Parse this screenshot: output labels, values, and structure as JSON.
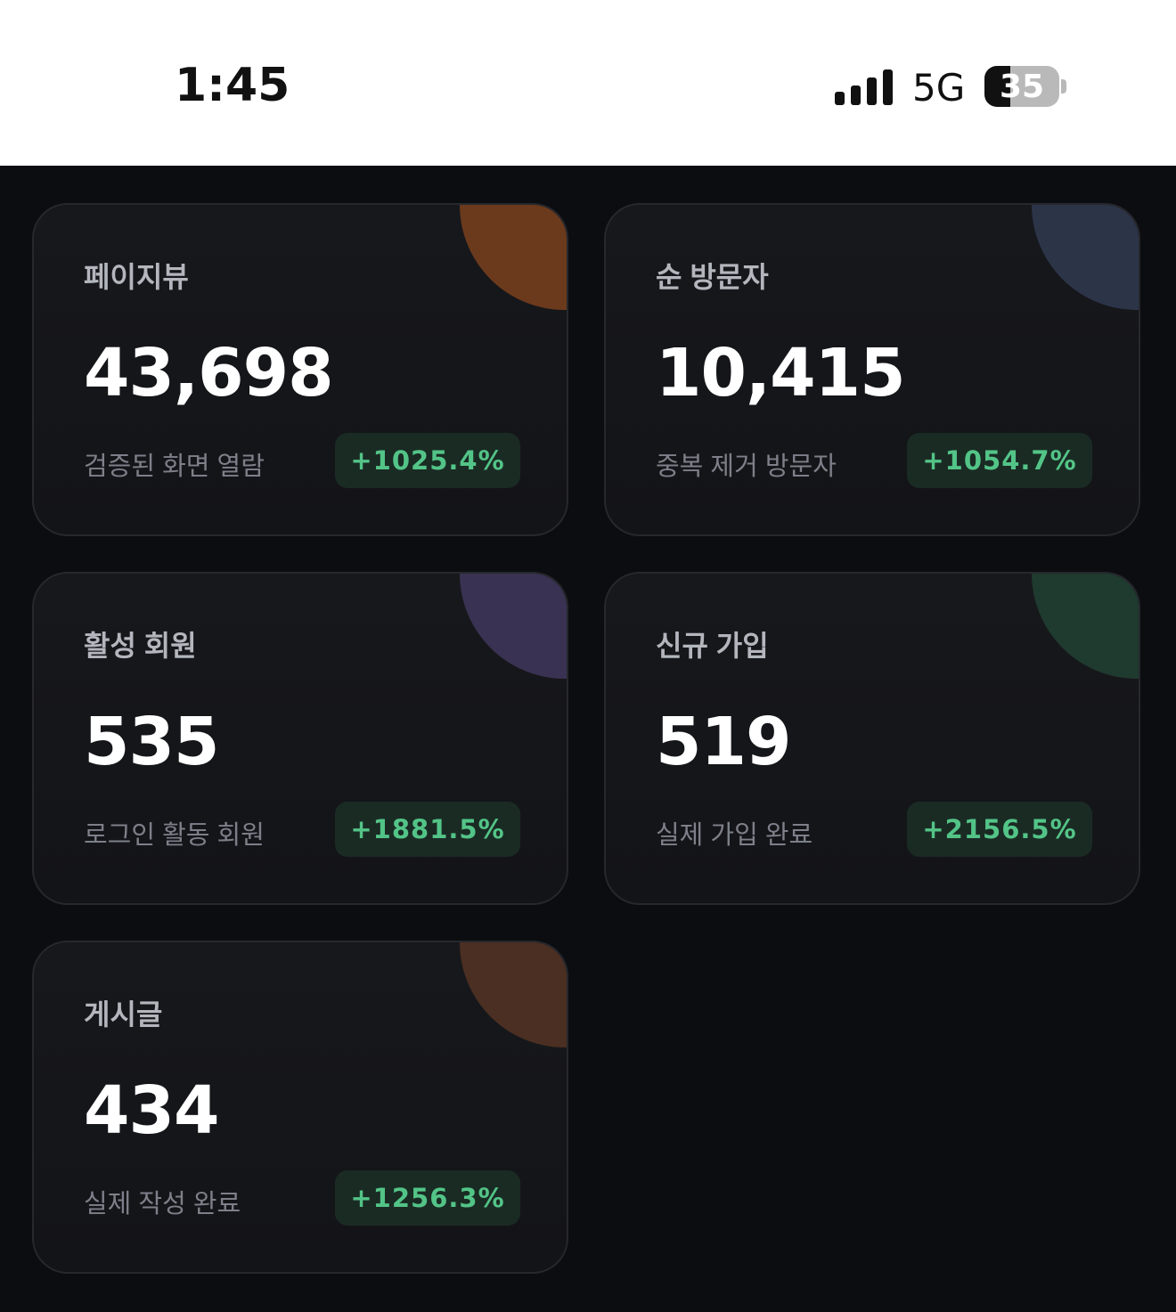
{
  "status_bar": {
    "time": "1:45",
    "network": "5G",
    "battery_level": "35",
    "battery_fraction": 0.35,
    "signal_bars": 4
  },
  "cards": [
    {
      "title": "페이지뷰",
      "value": "43,698",
      "subtitle": "검증된 화면 열람",
      "change": "+1025.4%",
      "accent_color": "#6b3a1c"
    },
    {
      "title": "순 방문자",
      "value": "10,415",
      "subtitle": "중복 제거 방문자",
      "change": "+1054.7%",
      "accent_color": "#2c3448"
    },
    {
      "title": "활성 회원",
      "value": "535",
      "subtitle": "로그인 활동 회원",
      "change": "+1881.5%",
      "accent_color": "#3a3252"
    },
    {
      "title": "신규 가입",
      "value": "519",
      "subtitle": "실제 가입 완료",
      "change": "+2156.5%",
      "accent_color": "#1f3a2e"
    },
    {
      "title": "게시글",
      "value": "434",
      "subtitle": "실제 작성 완료",
      "change": "+1256.3%",
      "accent_color": "#4a2f22"
    }
  ],
  "colors": {
    "background": "#0c0d10",
    "card_border": "#26282d",
    "positive": "#53c487",
    "positive_bg": "#1a2b24"
  }
}
